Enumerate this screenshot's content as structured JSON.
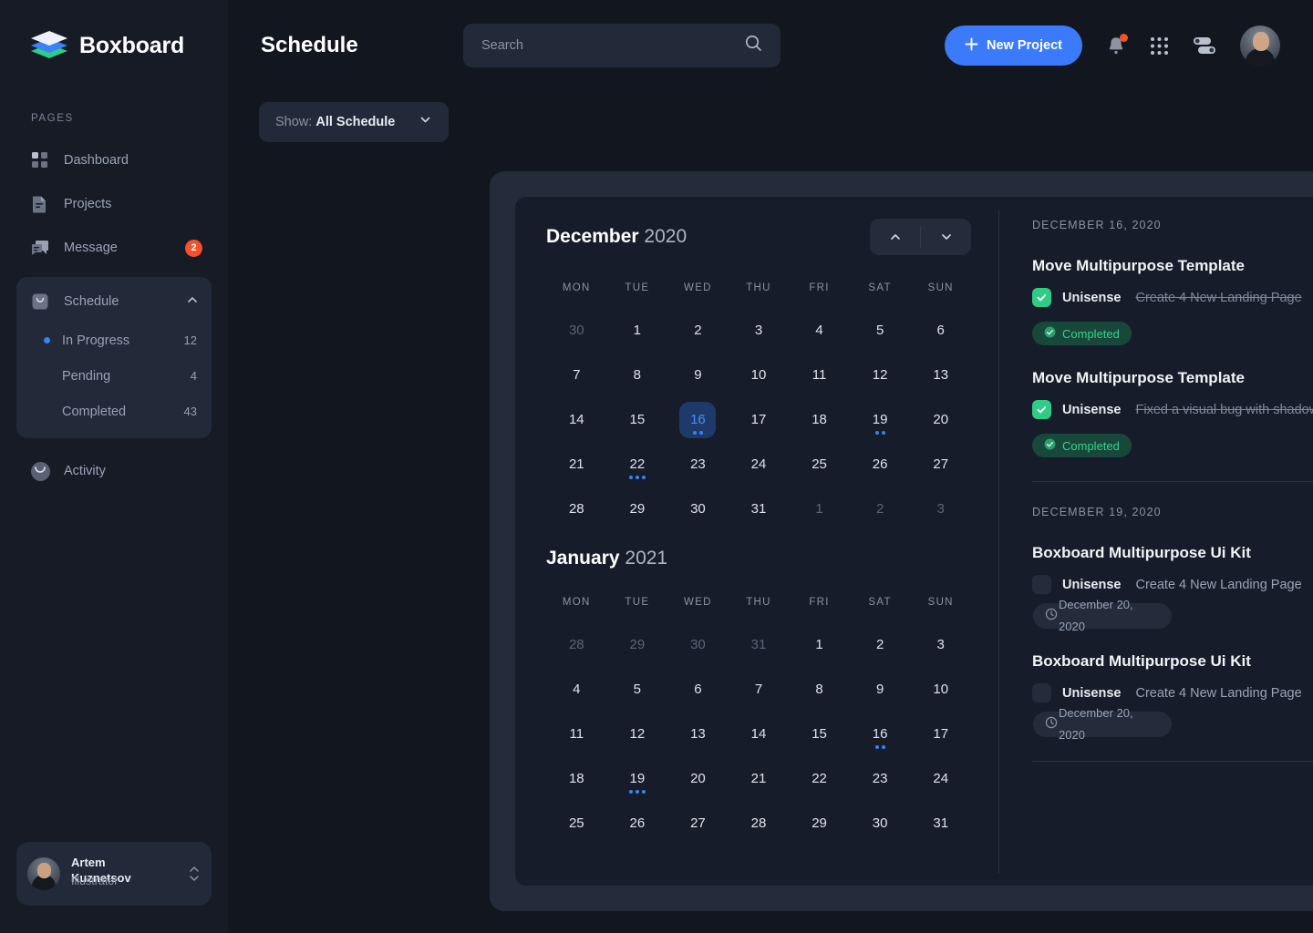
{
  "brand": {
    "name": "Boxboard",
    "logo_icon": "stacked-layers-logo"
  },
  "sidebar": {
    "section_label": "PAGES",
    "items": [
      {
        "label": "Dashboard",
        "icon": "grid-squares-icon"
      },
      {
        "label": "Projects",
        "icon": "document-icon"
      },
      {
        "label": "Message",
        "icon": "chat-bubbles-icon",
        "badge": "2"
      }
    ],
    "schedule": {
      "label": "Schedule",
      "icon": "calendar-icon",
      "chevron": "chevron-up-icon",
      "subitems": [
        {
          "label": "In Progress",
          "count": "12",
          "active": true
        },
        {
          "label": "Pending",
          "count": "4",
          "active": false
        },
        {
          "label": "Completed",
          "count": "43",
          "active": false
        }
      ]
    },
    "activity": {
      "label": "Activity",
      "icon": "smiley-circle-icon"
    },
    "profile": {
      "name": "Artem Kuznetsov",
      "role": "Illustrator",
      "avatar": "user-avatar",
      "stepper_icon": "up-down-chevron-icon"
    }
  },
  "header": {
    "title": "Schedule",
    "search": {
      "placeholder": "Search",
      "value": "",
      "icon": "search-icon"
    },
    "new_project_label": "New Project",
    "plus_icon": "plus-icon",
    "icons": {
      "notifications": "bell-icon",
      "apps": "apps-grid-icon",
      "settings": "sliders-toggle-icon",
      "avatar": "user-avatar"
    },
    "accent_color": "#3b7bfb",
    "notification_dot_color": "#f4512c"
  },
  "filter": {
    "prefix": "Show:",
    "value": "All Schedule",
    "chevron": "chevron-down-icon"
  },
  "calendars": [
    {
      "month": "December",
      "year": "2020",
      "dow": [
        "MON",
        "TUE",
        "WED",
        "THU",
        "FRI",
        "SAT",
        "SUN"
      ],
      "nav": {
        "up": "chevron-up-icon",
        "down": "chevron-down-icon"
      },
      "days": [
        {
          "n": "30",
          "muted": true
        },
        {
          "n": "1"
        },
        {
          "n": "2"
        },
        {
          "n": "3"
        },
        {
          "n": "4"
        },
        {
          "n": "5"
        },
        {
          "n": "6"
        },
        {
          "n": "7"
        },
        {
          "n": "8"
        },
        {
          "n": "9"
        },
        {
          "n": "10"
        },
        {
          "n": "11"
        },
        {
          "n": "12"
        },
        {
          "n": "13"
        },
        {
          "n": "14"
        },
        {
          "n": "15"
        },
        {
          "n": "16",
          "selected": true,
          "dots": 2
        },
        {
          "n": "17"
        },
        {
          "n": "18"
        },
        {
          "n": "19",
          "dots": 2
        },
        {
          "n": "20"
        },
        {
          "n": "21"
        },
        {
          "n": "22",
          "dots": 3
        },
        {
          "n": "23"
        },
        {
          "n": "24"
        },
        {
          "n": "25"
        },
        {
          "n": "26"
        },
        {
          "n": "27"
        },
        {
          "n": "28"
        },
        {
          "n": "29"
        },
        {
          "n": "30"
        },
        {
          "n": "31"
        },
        {
          "n": "1",
          "muted": true
        },
        {
          "n": "2",
          "muted": true
        },
        {
          "n": "3",
          "muted": true
        }
      ]
    },
    {
      "month": "January",
      "year": "2021",
      "dow": [
        "MON",
        "TUE",
        "WED",
        "THU",
        "FRI",
        "SAT",
        "SUN"
      ],
      "days": [
        {
          "n": "28",
          "muted": true
        },
        {
          "n": "29",
          "muted": true
        },
        {
          "n": "30",
          "muted": true
        },
        {
          "n": "31",
          "muted": true
        },
        {
          "n": "1"
        },
        {
          "n": "2"
        },
        {
          "n": "3"
        },
        {
          "n": "4"
        },
        {
          "n": "5"
        },
        {
          "n": "6"
        },
        {
          "n": "7"
        },
        {
          "n": "8"
        },
        {
          "n": "9"
        },
        {
          "n": "10"
        },
        {
          "n": "11"
        },
        {
          "n": "12"
        },
        {
          "n": "13"
        },
        {
          "n": "14"
        },
        {
          "n": "15"
        },
        {
          "n": "16",
          "dots": 2
        },
        {
          "n": "17"
        },
        {
          "n": "18"
        },
        {
          "n": "19",
          "dots": 3
        },
        {
          "n": "20"
        },
        {
          "n": "21"
        },
        {
          "n": "22"
        },
        {
          "n": "23"
        },
        {
          "n": "24"
        },
        {
          "n": "25"
        },
        {
          "n": "26"
        },
        {
          "n": "27"
        },
        {
          "n": "28"
        },
        {
          "n": "29"
        },
        {
          "n": "30"
        },
        {
          "n": "31"
        }
      ]
    }
  ],
  "task_groups": [
    {
      "date": "DECEMBER 16, 2020",
      "tasks": [
        {
          "title": "Move Multipurpose Template",
          "org": "Unisense",
          "desc": "Create 4 New  Landing Page",
          "checked": true,
          "status": "Completed",
          "status_icon": "check-circle-icon"
        },
        {
          "title": "Move Multipurpose Template",
          "org": "Unisense",
          "desc": "Fixed a visual bug with shadows in Figma",
          "checked": true,
          "status": "Completed",
          "status_icon": "check-circle-icon"
        }
      ]
    },
    {
      "date": "DECEMBER 19, 2020",
      "tasks": [
        {
          "title": "Boxboard Multipurpose Ui Kit",
          "org": "Unisense",
          "desc": "Create 4 New  Landing Page",
          "checked": false,
          "due": "December 20, 2020",
          "due_icon": "clock-icon"
        },
        {
          "title": "Boxboard Multipurpose Ui Kit",
          "org": "Unisense",
          "desc": "Create 4 New  Landing Page",
          "checked": false,
          "due": "December 20, 2020",
          "due_icon": "clock-icon"
        }
      ]
    }
  ],
  "colors": {
    "accent_blue": "#3b7bfb",
    "success_green": "#2ecc87",
    "danger_red": "#f4512c",
    "panel_bg": "#242b3a",
    "card_bg": "#161c29"
  }
}
